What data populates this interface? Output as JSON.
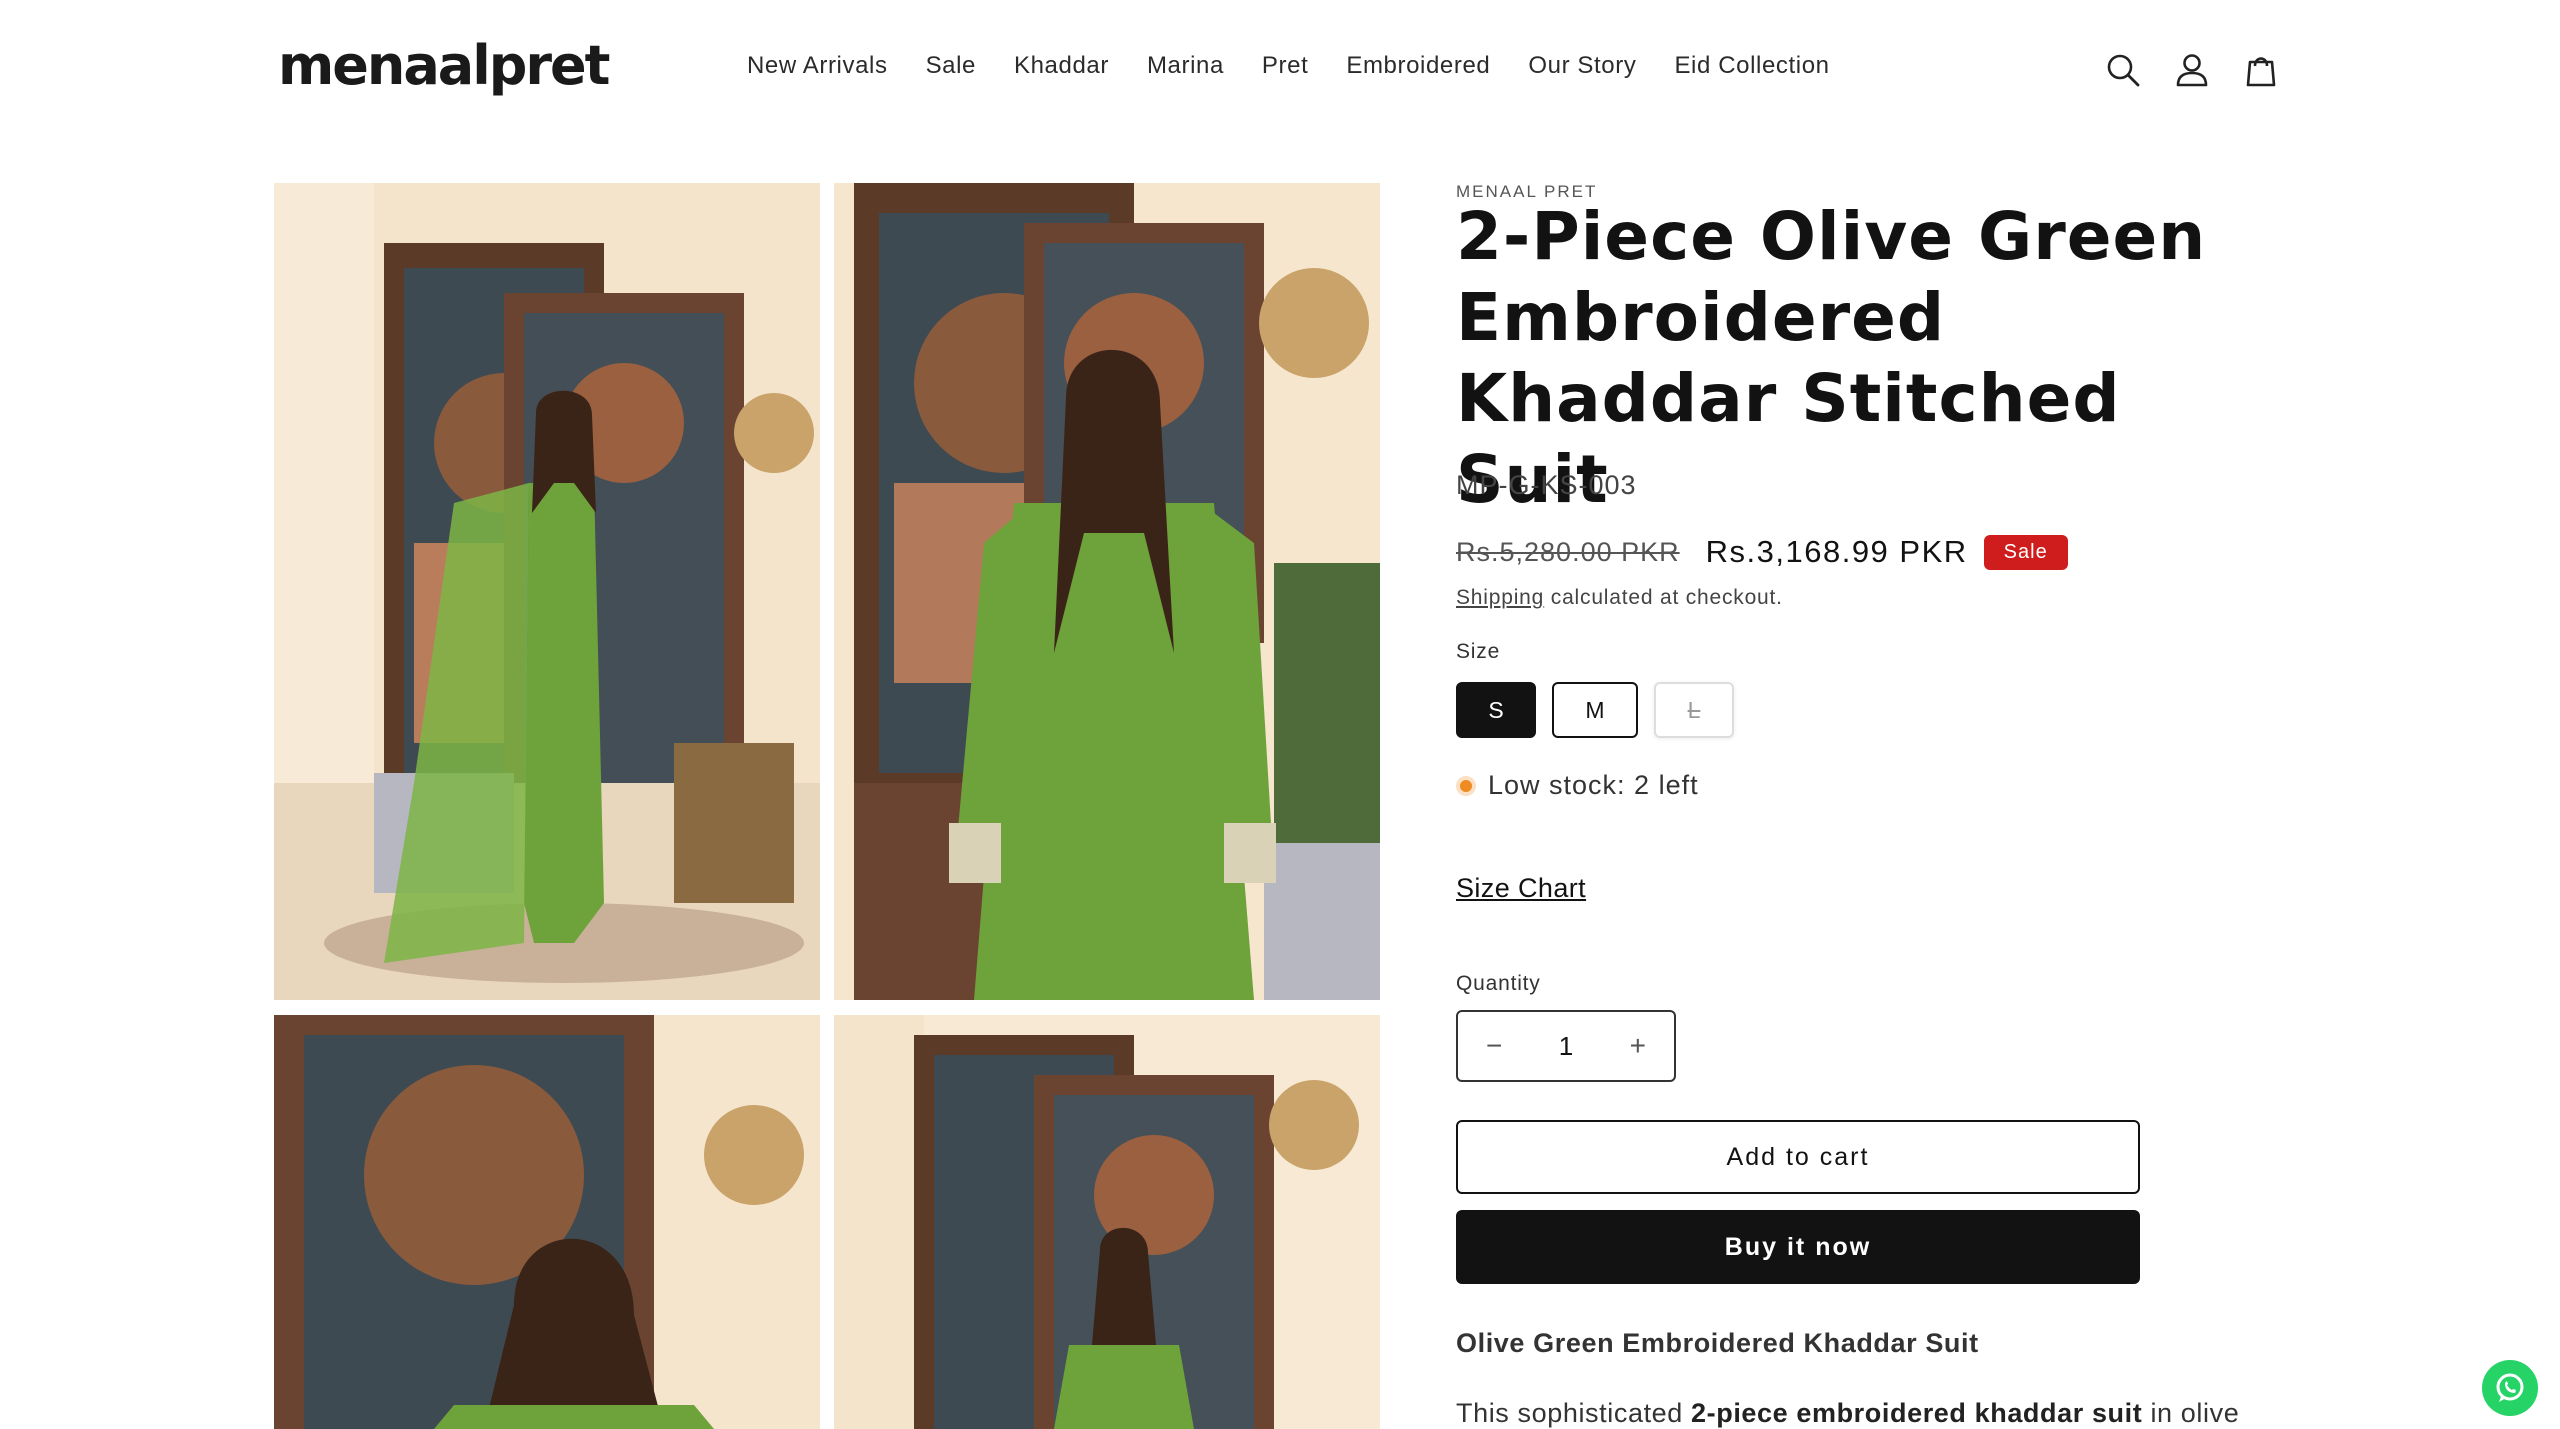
{
  "header": {
    "logo": "menaalpret",
    "nav": [
      "New Arrivals",
      "Sale",
      "Khaddar",
      "Marina",
      "Pret",
      "Embroidered",
      "Our Story",
      "Eid Collection"
    ]
  },
  "icons": [
    "search-icon",
    "account-icon",
    "cart-icon"
  ],
  "product": {
    "vendor": "MENAAL PRET",
    "title": "2-Piece Olive Green Embroidered Khaddar Stitched Suit",
    "sku": "MP-G-KS-003",
    "price_old": "Rs.5,280.00 PKR",
    "price_new": "Rs.3,168.99 PKR",
    "badge": "Sale",
    "shipping_link": "Shipping",
    "shipping_text": " calculated at checkout.",
    "size_label": "Size",
    "sizes": [
      "S",
      "M",
      "L"
    ],
    "selected_size": "S",
    "stock": "Low stock: 2 left",
    "size_chart": "Size Chart",
    "quantity_label": "Quantity",
    "quantity": "1",
    "qty_minus": "−",
    "qty_plus": "+",
    "add_to_cart": "Add to cart",
    "buy_now": "Buy it now",
    "description_title": "Olive Green Embroidered Khaddar Suit",
    "description_prefix": "This sophisticated ",
    "description_bold": "2-piece embroidered khaddar suit",
    "description_suffix": " in olive"
  },
  "colors": {
    "text": "#121212",
    "sale_badge": "#cf1d1d",
    "stock_dot": "#ef8b23",
    "dress_green": "#6ea23a",
    "whatsapp": "#25d366"
  }
}
